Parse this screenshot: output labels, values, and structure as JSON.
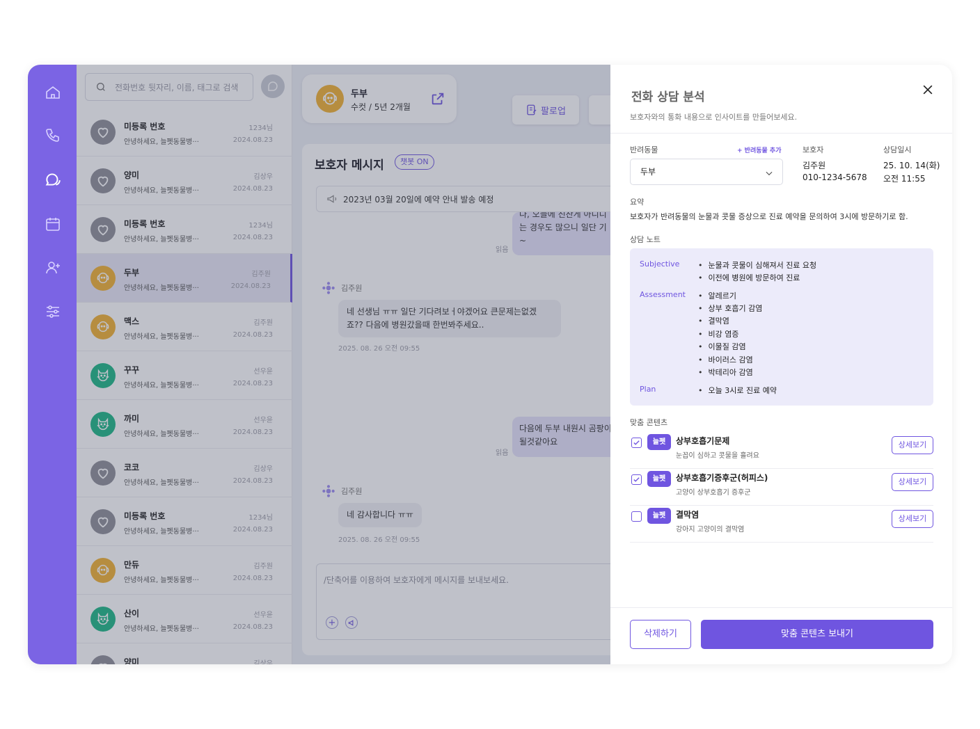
{
  "search": {
    "placeholder": "전화번호 뒷자리, 이름, 태그로 검색"
  },
  "conversations": [
    {
      "name": "미등록 번호",
      "preview": "안녕하세요, 늘펫동물병···",
      "meta": "1234님",
      "date": "2024.08.23",
      "avatar": "heart",
      "color": "#8f8f99"
    },
    {
      "name": "양미",
      "preview": "안녕하세요, 늘펫동물병···",
      "meta": "김상우",
      "date": "2024.08.23",
      "avatar": "heart",
      "color": "#8f8f99"
    },
    {
      "name": "미등록 번호",
      "preview": "안녕하세요, 늘펫동물병···",
      "meta": "1234님",
      "date": "2024.08.23",
      "avatar": "heart",
      "color": "#8f8f99"
    },
    {
      "name": "두부",
      "preview": "안녕하세요, 늘펫동물병···",
      "meta": "김주원",
      "date": "2024.08.23",
      "avatar": "dog",
      "color": "#f2b233",
      "selected": true
    },
    {
      "name": "맥스",
      "preview": "안녕하세요, 늘펫동물병···",
      "meta": "김주원",
      "date": "2024.08.23",
      "avatar": "dog",
      "color": "#f2b233"
    },
    {
      "name": "꾸꾸",
      "preview": "안녕하세요, 늘펫동물병···",
      "meta": "선우윤",
      "date": "2024.08.23",
      "avatar": "cat",
      "color": "#1fb886"
    },
    {
      "name": "까미",
      "preview": "안녕하세요, 늘펫동물병···",
      "meta": "선우윤",
      "date": "2024.08.23",
      "avatar": "cat",
      "color": "#1fb886"
    },
    {
      "name": "코코",
      "preview": "안녕하세요, 늘펫동물병···",
      "meta": "김상우",
      "date": "2024.08.23",
      "avatar": "heart",
      "color": "#8f8f99"
    },
    {
      "name": "미등록 번호",
      "preview": "안녕하세요, 늘펫동물병···",
      "meta": "1234님",
      "date": "2024.08.23",
      "avatar": "heart",
      "color": "#8f8f99"
    },
    {
      "name": "만듀",
      "preview": "안녕하세요, 늘펫동물병···",
      "meta": "김주원",
      "date": "2024.08.23",
      "avatar": "dog",
      "color": "#f2b233"
    },
    {
      "name": "산이",
      "preview": "안녕하세요, 늘펫동물병···",
      "meta": "선우윤",
      "date": "2024.08.23",
      "avatar": "cat",
      "color": "#1fb886"
    },
    {
      "name": "양미",
      "preview": "",
      "meta": "김상우",
      "date": "",
      "avatar": "heart",
      "color": "#8f8f99"
    }
  ],
  "pet_card": {
    "name": "두부",
    "info": "수컷 / 5년 2개월"
  },
  "toolbar": {
    "follow_label": "팔로업"
  },
  "messages": {
    "title": "보호자 메시지",
    "badge": "챗봇 ON",
    "notice": "2023년 03월 20일에 예약 안내 발송 예정",
    "out1_lines": [
      "다, 오늘에 진찬게 아니디",
      "는 경우도 많으니 일단 기",
      "~"
    ],
    "read1": "읽음",
    "in1_sender": "김주원",
    "in1_lines": [
      "네 선생님 ㅠㅠ 일단 기다려보ㅓ야겠어요 큰문제는없겠",
      "죠?? 다음에 병원갔을때 한번봐주세요.."
    ],
    "in1_time": "2025. 08. 26 오전 09:55",
    "out2_lines": [
      "다음에 두부 내원시 곰팡이",
      "될것같아요"
    ],
    "read2": "읽음",
    "in2_sender": "김주원",
    "in2_lines": [
      "네 감사합니다 ㅠㅠ"
    ],
    "in2_time": "2025. 08. 26 오전 09:55",
    "input_placeholder": "/단축어를 이용하여 보호자에게 메시지를 보내보세요."
  },
  "analysis": {
    "title": "전화 상담 분석",
    "subtitle": "보호자와의 통화 내용으로 인사이트를 만들어보세요.",
    "pet_label": "반려동물",
    "add_pet": "+ 반려동물 추가",
    "pet_value": "두부",
    "guardian_label": "보호자",
    "guardian_name": "김주원",
    "guardian_phone": "010-1234-5678",
    "datetime_label": "상담일시",
    "date": "25. 10. 14(화)",
    "time": "오전 11:55",
    "summary_label": "요약",
    "summary": "보호자가 반려동물의 눈물과 콧물 증상으로 진료 예약을 문의하여 3시에 방문하기로 함.",
    "notes_label": "상담 노트",
    "notes": {
      "subjective_label": "Subjective",
      "subjective": [
        "눈물과 콧물이 심해져서 진료 요청",
        "이전에 병원에 방문하여 진료"
      ],
      "assessment_label": "Assessment",
      "assessment": [
        "알레르기",
        "상부 호흡기 감염",
        "결막염",
        "비강 염증",
        "이물질 감염",
        "바이러스 감염",
        "박테리아 감염"
      ],
      "plan_label": "Plan",
      "plan": [
        "오늘 3시로 진료 예약"
      ]
    },
    "contents_label": "맞춤 콘텐츠",
    "contents": [
      {
        "tag": "늘펫",
        "title": "상부호흡기문제",
        "sub": "눈꼽이 심하고 콧물을 흘려요",
        "checked": true,
        "detail": "상세보기"
      },
      {
        "tag": "늘펫",
        "title": "상부호흡기증후군(허피스)",
        "sub": "고양이 상부호흡기 증후군",
        "checked": true,
        "detail": "상세보기"
      },
      {
        "tag": "늘펫",
        "title": "결막염",
        "sub": "강아지 고양이의 결막염",
        "checked": false,
        "detail": "상세보기"
      }
    ],
    "delete_label": "삭제하기",
    "send_label": "맞춤 콘텐츠 보내기"
  },
  "colors": {
    "accent": "#6f55e0",
    "rail": "#7b64e4",
    "dog_avatar": "#f2b233",
    "cat_avatar": "#1fb886",
    "unknown_avatar": "#8f8f99"
  }
}
